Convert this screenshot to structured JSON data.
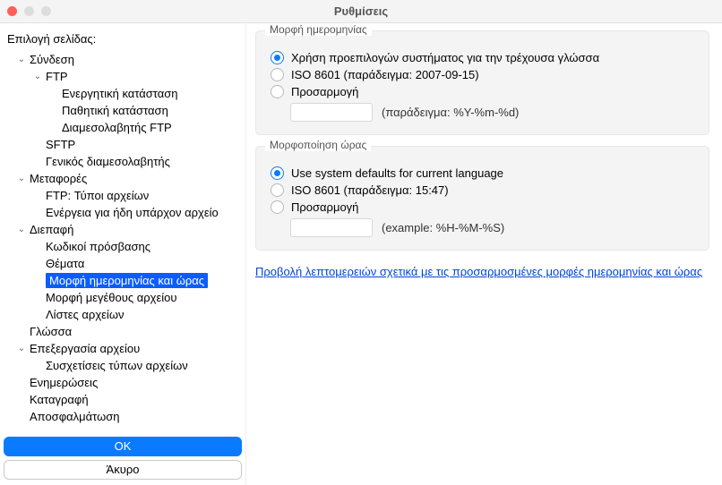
{
  "window": {
    "title": "Ρυθμίσεις"
  },
  "sidebar": {
    "header": "Επιλογή σελίδας:",
    "items": [
      {
        "label": "Σύνδεση",
        "depth": 0,
        "expand": "open"
      },
      {
        "label": "FTP",
        "depth": 1,
        "expand": "open"
      },
      {
        "label": "Ενεργητική κατάσταση",
        "depth": 2
      },
      {
        "label": "Παθητική κατάσταση",
        "depth": 2
      },
      {
        "label": "Διαμεσολαβητής FTP",
        "depth": 2
      },
      {
        "label": "SFTP",
        "depth": 1
      },
      {
        "label": "Γενικός διαμεσολαβητής",
        "depth": 1
      },
      {
        "label": "Μεταφορές",
        "depth": 0,
        "expand": "open"
      },
      {
        "label": "FTP: Τύποι αρχείων",
        "depth": 1
      },
      {
        "label": "Ενέργεια για ήδη υπάρχον αρχείο",
        "depth": 1
      },
      {
        "label": "Διεπαφή",
        "depth": 0,
        "expand": "open"
      },
      {
        "label": "Κωδικοί πρόσβασης",
        "depth": 1
      },
      {
        "label": "Θέματα",
        "depth": 1
      },
      {
        "label": "Μορφή ημερομηνίας και ώρας",
        "depth": 1,
        "selected": true
      },
      {
        "label": "Μορφή μεγέθους αρχείου",
        "depth": 1
      },
      {
        "label": "Λίστες αρχείων",
        "depth": 1
      },
      {
        "label": "Γλώσσα",
        "depth": 0
      },
      {
        "label": "Επεξεργασία αρχείου",
        "depth": 0,
        "expand": "open"
      },
      {
        "label": "Συσχετίσεις τύπων αρχείων",
        "depth": 1
      },
      {
        "label": "Ενημερώσεις",
        "depth": 0
      },
      {
        "label": "Καταγραφή",
        "depth": 0
      },
      {
        "label": "Αποσφαλμάτωση",
        "depth": 0
      }
    ],
    "ok": "OK",
    "cancel": "Άκυρο"
  },
  "main": {
    "date": {
      "legend": "Μορφή ημερομηνίας",
      "opt_system": "Χρήση προεπιλογών συστήματος για την τρέχουσα γλώσσα",
      "opt_iso": "ISO 8601 (παράδειγμα: 2007-09-15)",
      "opt_custom": "Προσαρμογή",
      "hint": "(παράδειγμα: %Y-%m-%d)"
    },
    "time": {
      "legend": "Μορφοποίηση ώρας",
      "opt_system": "Use system defaults for current language",
      "opt_iso": "ISO 8601 (παράδειγμα: 15:47)",
      "opt_custom": "Προσαρμογή",
      "hint": "(example: %H-%M-%S)"
    },
    "link": "Προβολή λεπτομερειών σχετικά με τις προσαρμοσμένες μορφές ημερομηνίας και ώρας"
  }
}
